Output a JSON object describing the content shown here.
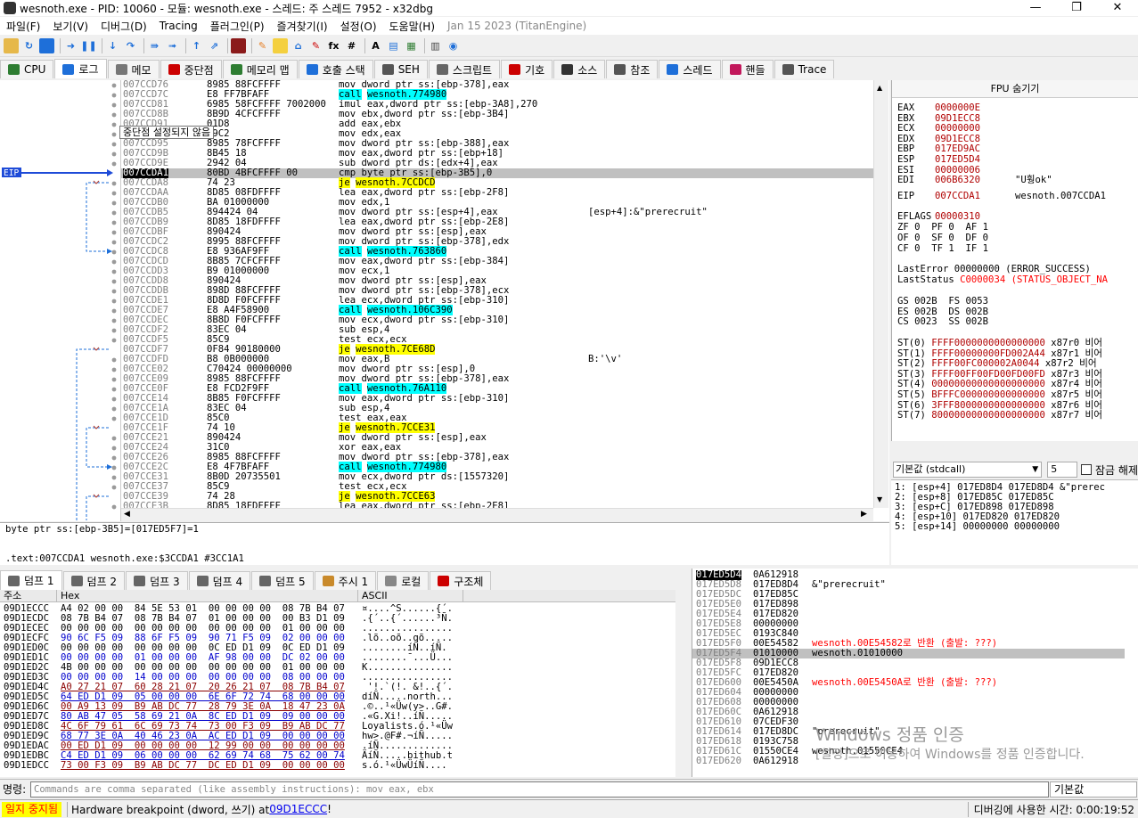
{
  "window": {
    "title": "wesnoth.exe - PID: 10060 - 모듈: wesnoth.exe - 스레드: 주 스레드 7952 - x32dbg",
    "min": "—",
    "max": "❐",
    "close": "✕"
  },
  "menu": [
    "파일(F)",
    "보기(V)",
    "디버그(D)",
    "Tracing",
    "플러그인(P)",
    "즐겨찾기(I)",
    "설정(O)",
    "도움말(H)"
  ],
  "menu_date": "Jan 15 2023 (TitanEngine)",
  "tabs": [
    {
      "label": "CPU",
      "icon": "cpu-icon",
      "color": "#2e7d32"
    },
    {
      "label": "로그",
      "icon": "log-icon",
      "color": "#1e6fd9"
    },
    {
      "label": "메모",
      "icon": "notes-icon",
      "color": "#777777"
    },
    {
      "label": "중단점",
      "icon": "breakpoint-icon",
      "color": "#cc0000"
    },
    {
      "label": "메모리 맵",
      "icon": "memory-map-icon",
      "color": "#2e7d32"
    },
    {
      "label": "호출 스택",
      "icon": "call-stack-icon",
      "color": "#1e6fd9"
    },
    {
      "label": "SEH",
      "icon": "seh-icon",
      "color": "#555555"
    },
    {
      "label": "스크립트",
      "icon": "script-icon",
      "color": "#666666"
    },
    {
      "label": "기호",
      "icon": "symbols-icon",
      "color": "#cc0000"
    },
    {
      "label": "소스",
      "icon": "source-icon",
      "color": "#333333"
    },
    {
      "label": "참조",
      "icon": "references-icon",
      "color": "#555555"
    },
    {
      "label": "스레드",
      "icon": "threads-icon",
      "color": "#1e6fd9"
    },
    {
      "label": "핸들",
      "icon": "handles-icon",
      "color": "#c2185b"
    },
    {
      "label": "Trace",
      "icon": "trace-icon",
      "color": "#555555"
    }
  ],
  "eip_label": "EIP",
  "tooltip": "중단점 설정되지 않음",
  "disasm": [
    {
      "a": "007CCD76",
      "b": "8985 88FCFFFF",
      "m": "mov",
      "o": "dword ptr ss:[ebp-378],eax",
      "c": ""
    },
    {
      "a": "007CCD7C",
      "b": "E8 FF7BFAFF",
      "m": "call",
      "o": "wesnoth.774980",
      "c": "",
      "k": "call"
    },
    {
      "a": "007CCD81",
      "b": "6985 58FCFFFF 7002000",
      "m": "imul",
      "o": "eax,dword ptr ss:[ebp-3A8],270",
      "c": ""
    },
    {
      "a": "007CCD8B",
      "b": "8B9D 4CFCFFFF",
      "m": "mov",
      "o": "ebx,dword ptr ss:[ebp-3B4]",
      "c": ""
    },
    {
      "a": "007CCD91",
      "b": "01D8",
      "m": "add",
      "o": "eax,ebx",
      "c": ""
    },
    {
      "a": "007CCD93",
      "b": "89C2",
      "m": "mov",
      "o": "edx,eax",
      "c": ""
    },
    {
      "a": "007CCD95",
      "b": "8985 78FCFFFF",
      "m": "mov",
      "o": "dword ptr ss:[ebp-388],eax",
      "c": ""
    },
    {
      "a": "007CCD9B",
      "b": "8B45 18",
      "m": "mov",
      "o": "eax,dword ptr ss:[ebp+18]",
      "c": ""
    },
    {
      "a": "007CCD9E",
      "b": "2942 04",
      "m": "sub",
      "o": "dword ptr ds:[edx+4],eax",
      "c": ""
    },
    {
      "a": "007CCDA1",
      "b": "80BD 4BFCFFFF 00",
      "m": "cmp",
      "o": "byte ptr ss:[ebp-3B5],0",
      "c": "",
      "k": "eip"
    },
    {
      "a": "007CCDA8",
      "b": "74 23",
      "m": "je",
      "o": "wesnoth.7CCDCD",
      "c": "",
      "k": "jmp"
    },
    {
      "a": "007CCDAA",
      "b": "8D85 08FDFFFF",
      "m": "lea",
      "o": "eax,dword ptr ss:[ebp-2F8]",
      "c": ""
    },
    {
      "a": "007CCDB0",
      "b": "BA 01000000",
      "m": "mov",
      "o": "edx,1",
      "c": ""
    },
    {
      "a": "007CCDB5",
      "b": "894424 04",
      "m": "mov",
      "o": "dword ptr ss:[esp+4],eax",
      "c": "[esp+4]:&\"prerecruit\""
    },
    {
      "a": "007CCDB9",
      "b": "8D85 18FDFFFF",
      "m": "lea",
      "o": "eax,dword ptr ss:[ebp-2E8]",
      "c": ""
    },
    {
      "a": "007CCDBF",
      "b": "890424",
      "m": "mov",
      "o": "dword ptr ss:[esp],eax",
      "c": ""
    },
    {
      "a": "007CCDC2",
      "b": "8995 88FCFFFF",
      "m": "mov",
      "o": "dword ptr ss:[ebp-378],edx",
      "c": ""
    },
    {
      "a": "007CCDC8",
      "b": "E8 936AF9FF",
      "m": "call",
      "o": "wesnoth.763860",
      "c": "",
      "k": "call"
    },
    {
      "a": "007CCDCD",
      "b": "8B85 7CFCFFFF",
      "m": "mov",
      "o": "eax,dword ptr ss:[ebp-384]",
      "c": ""
    },
    {
      "a": "007CCDD3",
      "b": "B9 01000000",
      "m": "mov",
      "o": "ecx,1",
      "c": ""
    },
    {
      "a": "007CCDD8",
      "b": "890424",
      "m": "mov",
      "o": "dword ptr ss:[esp],eax",
      "c": ""
    },
    {
      "a": "007CCDDB",
      "b": "898D 88FCFFFF",
      "m": "mov",
      "o": "dword ptr ss:[ebp-378],ecx",
      "c": ""
    },
    {
      "a": "007CCDE1",
      "b": "8D8D F0FCFFFF",
      "m": "lea",
      "o": "ecx,dword ptr ss:[ebp-310]",
      "c": ""
    },
    {
      "a": "007CCDE7",
      "b": "E8 A4F58900",
      "m": "call",
      "o": "wesnoth.106C390",
      "c": "",
      "k": "call"
    },
    {
      "a": "007CCDEC",
      "b": "8B8D F0FCFFFF",
      "m": "mov",
      "o": "ecx,dword ptr ss:[ebp-310]",
      "c": ""
    },
    {
      "a": "007CCDF2",
      "b": "83EC 04",
      "m": "sub",
      "o": "esp,4",
      "c": ""
    },
    {
      "a": "007CCDF5",
      "b": "85C9",
      "m": "test",
      "o": "ecx,ecx",
      "c": ""
    },
    {
      "a": "007CCDF7",
      "b": "0F84 90180000",
      "m": "je",
      "o": "wesnoth.7CE68D",
      "c": "",
      "k": "jmp"
    },
    {
      "a": "007CCDFD",
      "b": "B8 0B000000",
      "m": "mov",
      "o": "eax,B",
      "c": "B:'\\v'"
    },
    {
      "a": "007CCE02",
      "b": "C70424 00000000",
      "m": "mov",
      "o": "dword ptr ss:[esp],0",
      "c": ""
    },
    {
      "a": "007CCE09",
      "b": "8985 88FCFFFF",
      "m": "mov",
      "o": "dword ptr ss:[ebp-378],eax",
      "c": ""
    },
    {
      "a": "007CCE0F",
      "b": "E8 FCD2F9FF",
      "m": "call",
      "o": "wesnoth.76A110",
      "c": "",
      "k": "call"
    },
    {
      "a": "007CCE14",
      "b": "8B85 F0FCFFFF",
      "m": "mov",
      "o": "eax,dword ptr ss:[ebp-310]",
      "c": ""
    },
    {
      "a": "007CCE1A",
      "b": "83EC 04",
      "m": "sub",
      "o": "esp,4",
      "c": ""
    },
    {
      "a": "007CCE1D",
      "b": "85C0",
      "m": "test",
      "o": "eax,eax",
      "c": ""
    },
    {
      "a": "007CCE1F",
      "b": "74 10",
      "m": "je",
      "o": "wesnoth.7CCE31",
      "c": "",
      "k": "jmp"
    },
    {
      "a": "007CCE21",
      "b": "890424",
      "m": "mov",
      "o": "dword ptr ss:[esp],eax",
      "c": ""
    },
    {
      "a": "007CCE24",
      "b": "31C0",
      "m": "xor",
      "o": "eax,eax",
      "c": ""
    },
    {
      "a": "007CCE26",
      "b": "8985 88FCFFFF",
      "m": "mov",
      "o": "dword ptr ss:[ebp-378],eax",
      "c": ""
    },
    {
      "a": "007CCE2C",
      "b": "E8 4F7BFAFF",
      "m": "call",
      "o": "wesnoth.774980",
      "c": "",
      "k": "call"
    },
    {
      "a": "007CCE31",
      "b": "8B0D 20735501",
      "m": "mov",
      "o": "ecx,dword ptr ds:[1557320]",
      "c": ""
    },
    {
      "a": "007CCE37",
      "b": "85C9",
      "m": "test",
      "o": "ecx,ecx",
      "c": ""
    },
    {
      "a": "007CCE39",
      "b": "74 28",
      "m": "je",
      "o": "wesnoth.7CCE63",
      "c": "",
      "k": "jmp"
    },
    {
      "a": "007CCE3B",
      "b": "8D85 18FDFFFF",
      "m": "lea",
      "o": "eax,dword ptr ss:[ebp-2E8]",
      "c": ""
    }
  ],
  "info": {
    "line1": "byte ptr ss:[ebp-3B5]=[017ED5F7]=1",
    "line2": ".text:007CCDA1 wesnoth.exe:$3CCDA1 #3CC1A1"
  },
  "fpu_title": "FPU 숨기기",
  "regs": [
    {
      "n": "EAX",
      "v": "0000000E",
      "c": ""
    },
    {
      "n": "EBX",
      "v": "09D1ECC8",
      "c": ""
    },
    {
      "n": "ECX",
      "v": "00000000",
      "c": ""
    },
    {
      "n": "EDX",
      "v": "09D1ECC8",
      "c": ""
    },
    {
      "n": "EBP",
      "v": "017ED9AC",
      "c": ""
    },
    {
      "n": "ESP",
      "v": "017ED5D4",
      "c": ""
    },
    {
      "n": "ESI",
      "v": "00000006",
      "c": ""
    },
    {
      "n": "EDI",
      "v": "006B6320",
      "c": "\"U훵ok\""
    },
    {
      "n": "EIP",
      "v": "007CCDA1",
      "c": "wesnoth.007CCDA1"
    }
  ],
  "eflags": {
    "label": "EFLAGS",
    "value": "00000310"
  },
  "flags_rows": [
    "ZF 0  PF 0  AF 1",
    "OF 0  SF 0  DF 0",
    "CF 0  TF 1  IF 1"
  ],
  "lasterror": {
    "label": "LastError",
    "value": "00000000 (ERROR_SUCCESS)"
  },
  "laststatus": {
    "label": "LastStatus",
    "value": "C0000034 (STATUS_OBJECT_NA"
  },
  "segs": [
    "GS 002B  FS 0053",
    "ES 002B  DS 002B",
    "CS 0023  SS 002B"
  ],
  "st": [
    {
      "n": "ST(0)",
      "v": "FFFF0000000000000000",
      "t": "x87r0 비어"
    },
    {
      "n": "ST(1)",
      "v": "FFFF00000000FD002A44",
      "t": "x87r1 비어"
    },
    {
      "n": "ST(2)",
      "v": "FFFF00FC000002A0044",
      "t": "x87r2 비어"
    },
    {
      "n": "ST(3)",
      "v": "FFFF00FF00FD00FD00FD",
      "t": "x87r3 비어"
    },
    {
      "n": "ST(4)",
      "v": "00000000000000000000",
      "t": "x87r4 비어"
    },
    {
      "n": "ST(5)",
      "v": "BFFFC000000000000000",
      "t": "x87r5 비어"
    },
    {
      "n": "ST(6)",
      "v": "3FFF8000000000000000",
      "t": "x87r6 비어"
    },
    {
      "n": "ST(7)",
      "v": "80000000000000000000",
      "t": "x87r7 비어"
    }
  ],
  "callconv": {
    "selected": "기본값 (stdcall)",
    "count": "5",
    "lock_label": "잠금 해제"
  },
  "callstack": [
    "1: [esp+4]  017ED8D4 017ED8D4 &\"prerec",
    "2: [esp+8]  017ED85C 017ED85C",
    "3: [esp+C]  017ED898 017ED898",
    "4: [esp+10] 017ED820 017ED820",
    "5: [esp+14] 00000000 00000000"
  ],
  "dumptabs": [
    "덤프 1",
    "덤프 2",
    "덤프 3",
    "덤프 4",
    "덤프 5",
    "주시 1",
    "로컬",
    "구조체"
  ],
  "dump_headers": {
    "addr": "주소",
    "hex": "Hex",
    "ascii": "ASCII"
  },
  "dump": [
    {
      "a": "09D1ECCC",
      "h": "A4 02 00 00  84 5E 53 01  00 00 00 00  08 7B B4 07",
      "s": "¤....^S......{´."
    },
    {
      "a": "09D1ECDC",
      "h": "08 7B B4 07  08 7B B4 07  01 00 00 00  00 B3 D1 09",
      "s": ".{´..{´......³Ñ."
    },
    {
      "a": "09D1ECEC",
      "h": "00 00 00 00  00 00 00 00  00 00 00 00  01 00 00 00",
      "s": "................"
    },
    {
      "a": "09D1ECFC",
      "h": "90 6C F5 09  88 6F F5 09  90 71 F5 09  02 00 00 00",
      "s": ".lõ..oõ..qõ....."
    },
    {
      "a": "09D1ED0C",
      "h": "00 00 00 00  00 00 00 00  0C ED D1 09  0C ED D1 09",
      "s": "........íÑ..íÑ."
    },
    {
      "a": "09D1ED1C",
      "h": "00 00 00 00  01 00 00 00  AF 98 00 00  DC 02 00 00",
      "s": "........¯...Ü..."
    },
    {
      "a": "09D1ED2C",
      "h": "4B 00 00 00  00 00 00 00  00 00 00 00  01 00 00 00",
      "s": "K..............."
    },
    {
      "a": "09D1ED3C",
      "h": "00 00 00 00  14 00 00 00  00 00 00 00  08 00 00 00",
      "s": "................"
    },
    {
      "a": "09D1ED4C",
      "h": "A0 27 21 07  60 28 21 07  20 26 21 07  08 7B B4 07",
      "s": " '!.`(!. &!..{´."
    },
    {
      "a": "09D1ED5C",
      "h": "64 ED D1 09  05 00 00 00  6E 6F 72 74  68 00 00 00",
      "s": "díÑ.....north..."
    },
    {
      "a": "09D1ED6C",
      "h": "00 A9 13 09  B9 AB DC 77  28 79 3E 0A  18 47 23 0A",
      "s": ".©..¹«Üw(y>..G#."
    },
    {
      "a": "09D1ED7C",
      "h": "80 AB 47 05  58 69 21 0A  8C ED D1 09  09 00 00 00",
      "s": ".«G.Xi!..íÑ....."
    },
    {
      "a": "09D1ED8C",
      "h": "4C 6F 79 61  6C 69 73 74  73 00 F3 09  B9 AB DC 77",
      "s": "Loyalists.ó.¹«Üw"
    },
    {
      "a": "09D1ED9C",
      "h": "68 77 3E 0A  40 46 23 0A  AC ED D1 09  00 00 00 00",
      "s": "hw>.@F#.¬íÑ....."
    },
    {
      "a": "09D1EDAC",
      "h": "00 ED D1 09  00 00 00 00  12 99 00 00  00 00 00 00",
      "s": ".íÑ............."
    },
    {
      "a": "09D1EDBC",
      "h": "C4 ED D1 09  06 00 00 00  62 69 74 68  75 62 00 74",
      "s": "ÄíÑ.....bithub.t"
    },
    {
      "a": "09D1EDCC",
      "h": "73 00 F3 09  B9 AB DC 77  DC ED D1 09  00 00 00 00",
      "s": "s.ó.¹«ÜwÜíÑ...."
    }
  ],
  "stack": [
    {
      "a": "017ED5D4",
      "v": "0A612918",
      "c": "",
      "k": "top"
    },
    {
      "a": "017ED5D8",
      "v": "017ED8D4",
      "c": "&\"prerecruit\""
    },
    {
      "a": "017ED5DC",
      "v": "017ED85C",
      "c": ""
    },
    {
      "a": "017ED5E0",
      "v": "017ED898",
      "c": ""
    },
    {
      "a": "017ED5E4",
      "v": "017ED820",
      "c": ""
    },
    {
      "a": "017ED5E8",
      "v": "00000000",
      "c": ""
    },
    {
      "a": "017ED5EC",
      "v": "0193C840",
      "c": ""
    },
    {
      "a": "017ED5F0",
      "v": "00E54582",
      "c": "wesnoth.00E54582로 반환 (출발: ???)",
      "k": "ret"
    },
    {
      "a": "017ED5F4",
      "v": "01010000",
      "c": "wesnoth.01010000",
      "k": "cur"
    },
    {
      "a": "017ED5F8",
      "v": "09D1ECC8",
      "c": ""
    },
    {
      "a": "017ED5FC",
      "v": "017ED820",
      "c": ""
    },
    {
      "a": "017ED600",
      "v": "00E5450A",
      "c": "wesnoth.00E5450A로 반환 (출발: ???)",
      "k": "ret"
    },
    {
      "a": "017ED604",
      "v": "00000000",
      "c": ""
    },
    {
      "a": "017ED608",
      "v": "00000000",
      "c": ""
    },
    {
      "a": "017ED60C",
      "v": "0A612918",
      "c": ""
    },
    {
      "a": "017ED610",
      "v": "07CEDF30",
      "c": ""
    },
    {
      "a": "017ED614",
      "v": "017ED8DC",
      "c": "\"prerecruit\""
    },
    {
      "a": "017ED618",
      "v": "0193C758",
      "c": ""
    },
    {
      "a": "017ED61C",
      "v": "01550CE4",
      "c": "wesnoth.01550CE4"
    },
    {
      "a": "017ED620",
      "v": "0A612918",
      "c": ""
    }
  ],
  "watermark": {
    "line1": "Windows 정품 인증",
    "line2": "[설정]으로 이동하여 Windows를 정품 인증합니다."
  },
  "command": {
    "label": "명령:",
    "placeholder": "Commands are comma separated (like assembly instructions): mov eax, ebx",
    "mode": "기본값"
  },
  "status": {
    "state": "일지 중지됨",
    "message": "Hardware breakpoint (dword, 쓰기) at ",
    "link": "09D1ECCC",
    "bang": "!",
    "timer": "디버깅에 사용한 시간: 0:00:19:52"
  },
  "colors": {
    "highlight": "#ffff00",
    "call": "#00ffff",
    "addr": "#808080",
    "red": "#ff0000"
  }
}
